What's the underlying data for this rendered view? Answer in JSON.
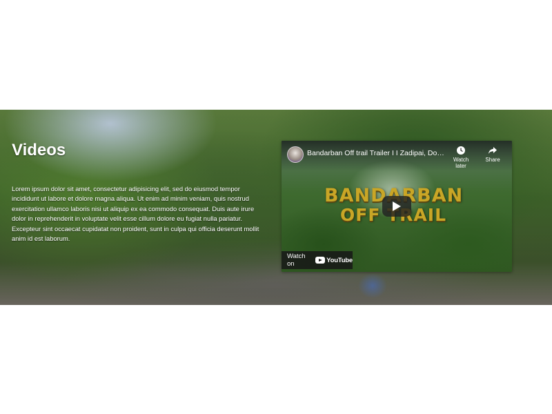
{
  "section": {
    "title": "Videos",
    "description": "Lorem ipsum dolor sit amet, consectetur adipisicing elit, sed do eiusmod tempor incididunt ut labore et dolore magna aliqua. Ut enim ad minim veniam, quis nostrud exercitation ullamco laboris nisi ut aliquip ex ea commodo consequat. Duis aute irure dolor in reprehenderit in voluptate velit esse cillum dolore eu fugiat nulla pariatur. Excepteur sint occaecat cupidatat non proident, sunt in culpa qui officia deserunt mollit anim id est laborum."
  },
  "video": {
    "title": "Bandarban Off trail Trailer I I Zadipai, Dolu...",
    "watch_later_label": "Watch later",
    "share_label": "Share",
    "thumbnail_line1": "BANDARBAN",
    "thumbnail_line2": "OFF TRAIL",
    "watch_on_label": "Watch on",
    "youtube_label": "YouTube"
  },
  "colors": {
    "thumbnail_text": "#c9a626",
    "overlay": "#171717"
  }
}
